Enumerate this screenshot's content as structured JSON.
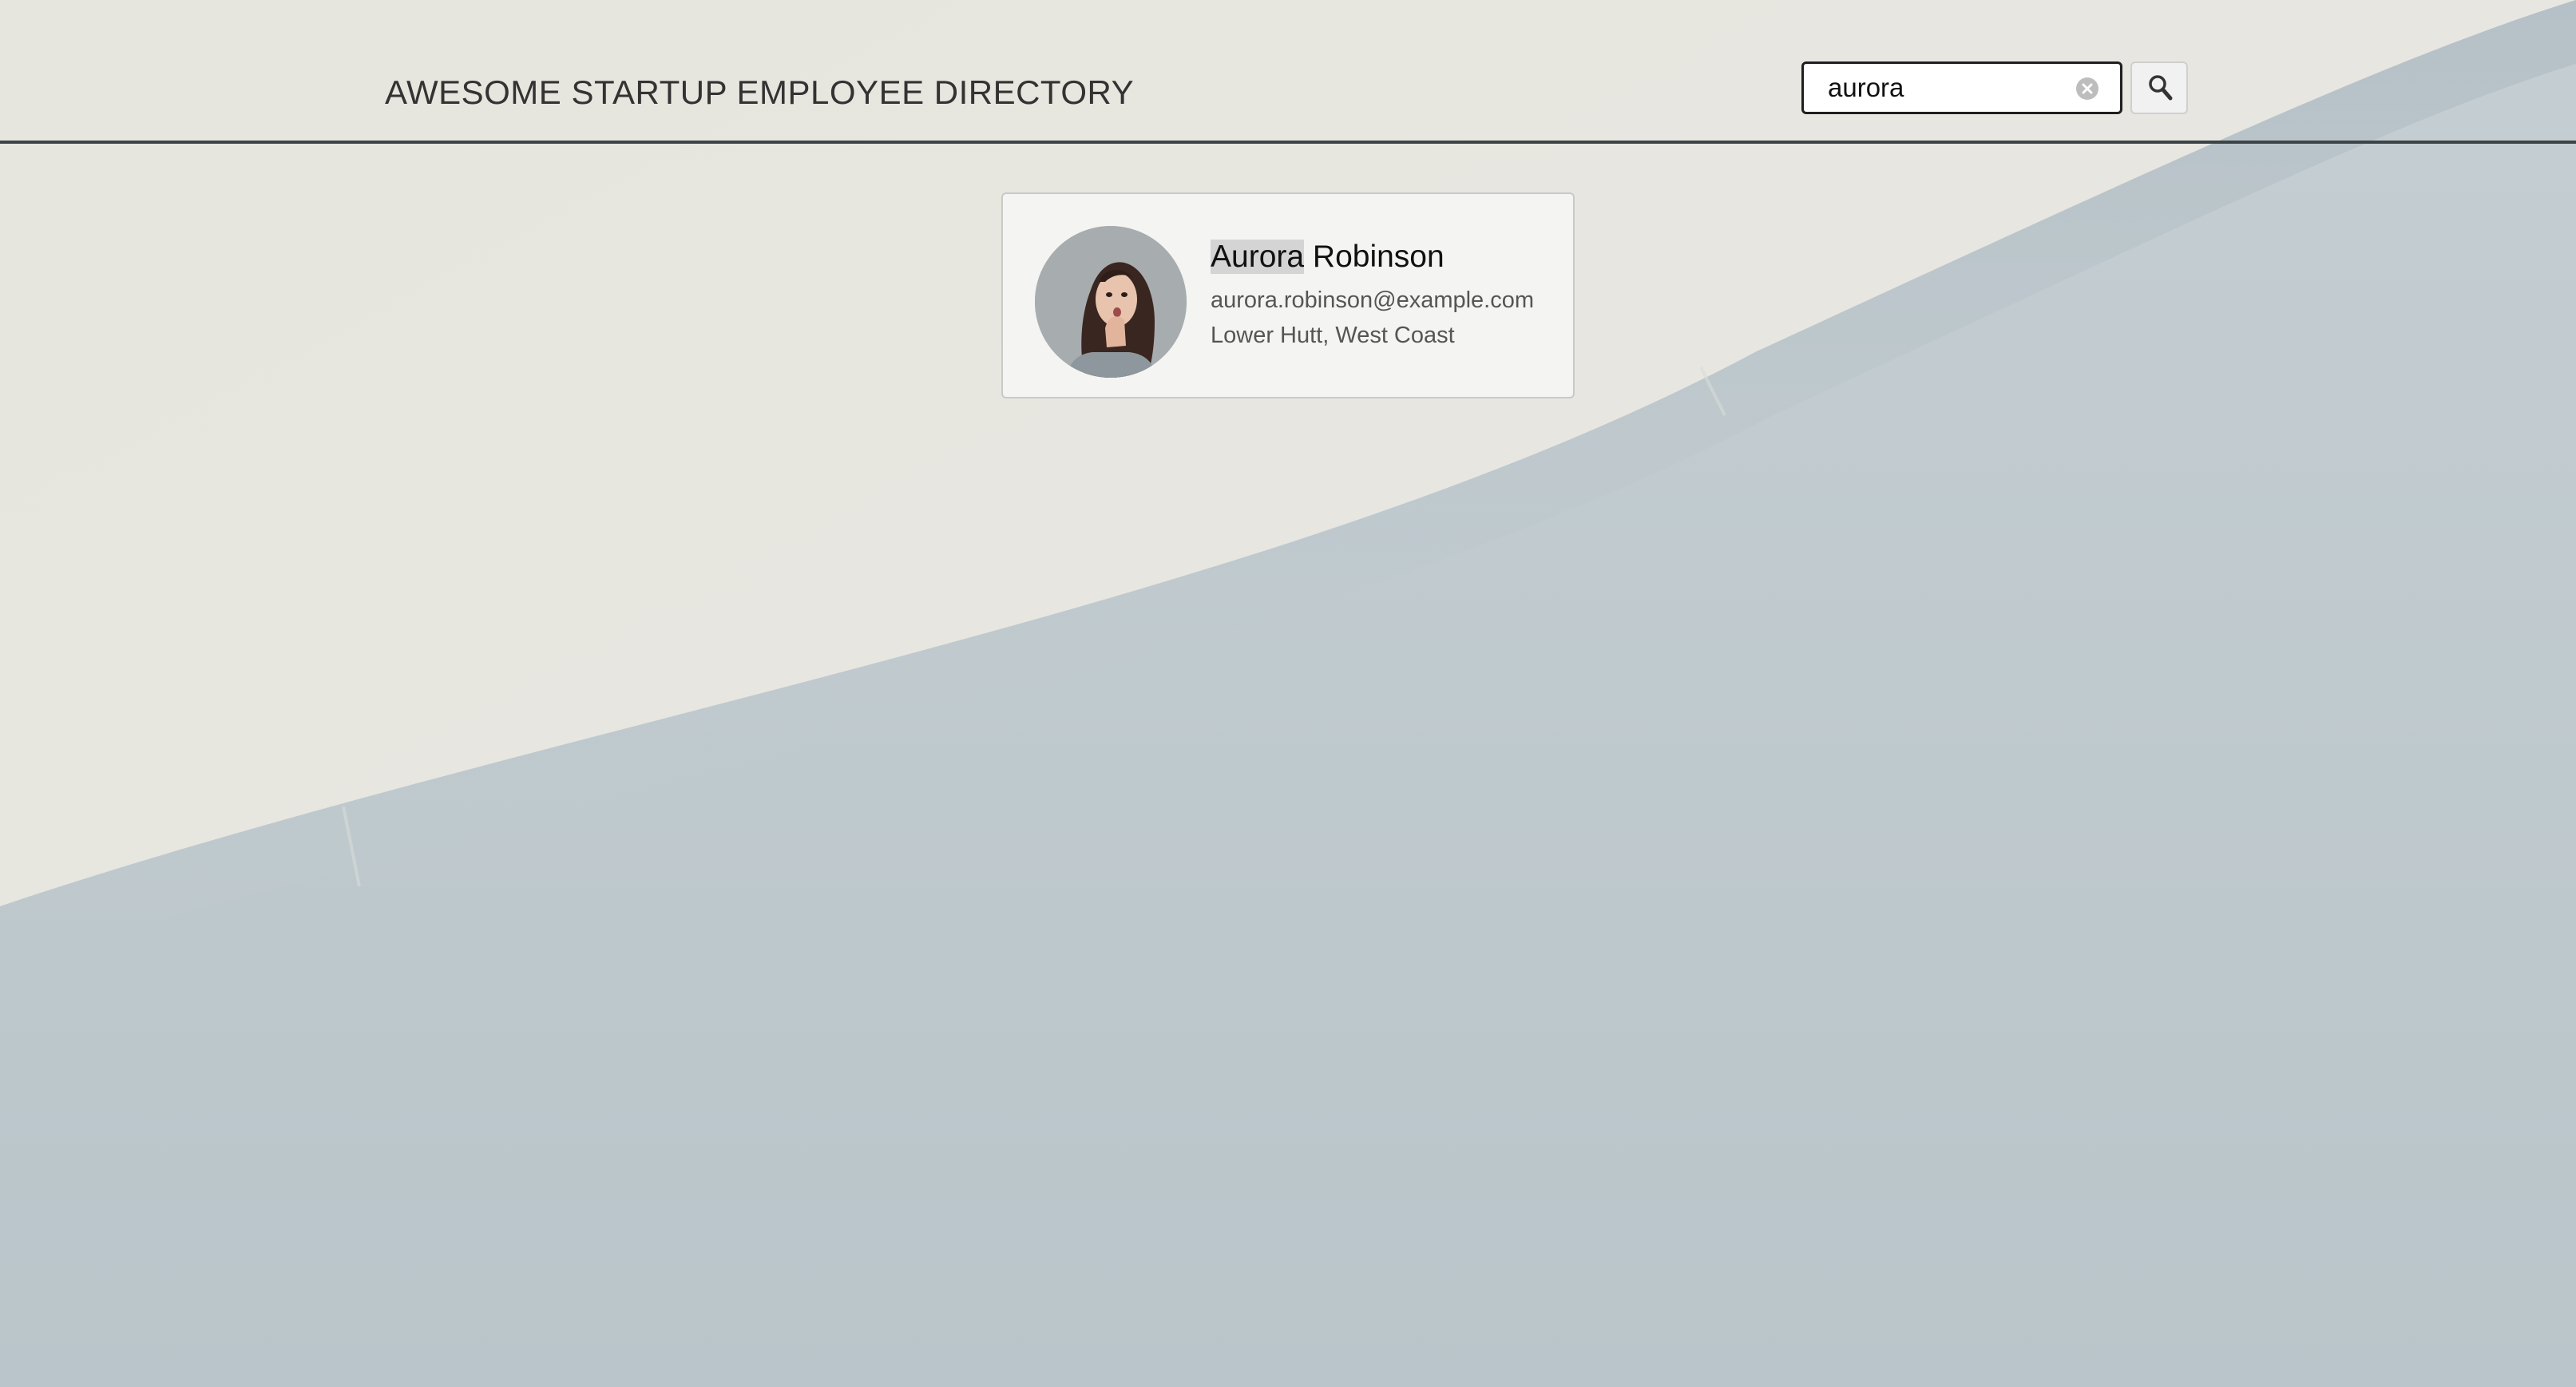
{
  "app": {
    "title": "AWESOME STARTUP EMPLOYEE DIRECTORY"
  },
  "search": {
    "value": "aurora",
    "clear_icon": "clear-circle-icon",
    "submit_icon": "magnifier-icon"
  },
  "results": [
    {
      "name_highlight": "Aurora",
      "name_rest": " Robinson",
      "email": "aurora.robinson@example.com",
      "location": "Lower Hutt, West Coast"
    }
  ],
  "colors": {
    "header_rule": "#3d4447",
    "card_background": "#f4f4f2",
    "highlight": "#d4d4d4",
    "page_background": "#e7e6df"
  }
}
